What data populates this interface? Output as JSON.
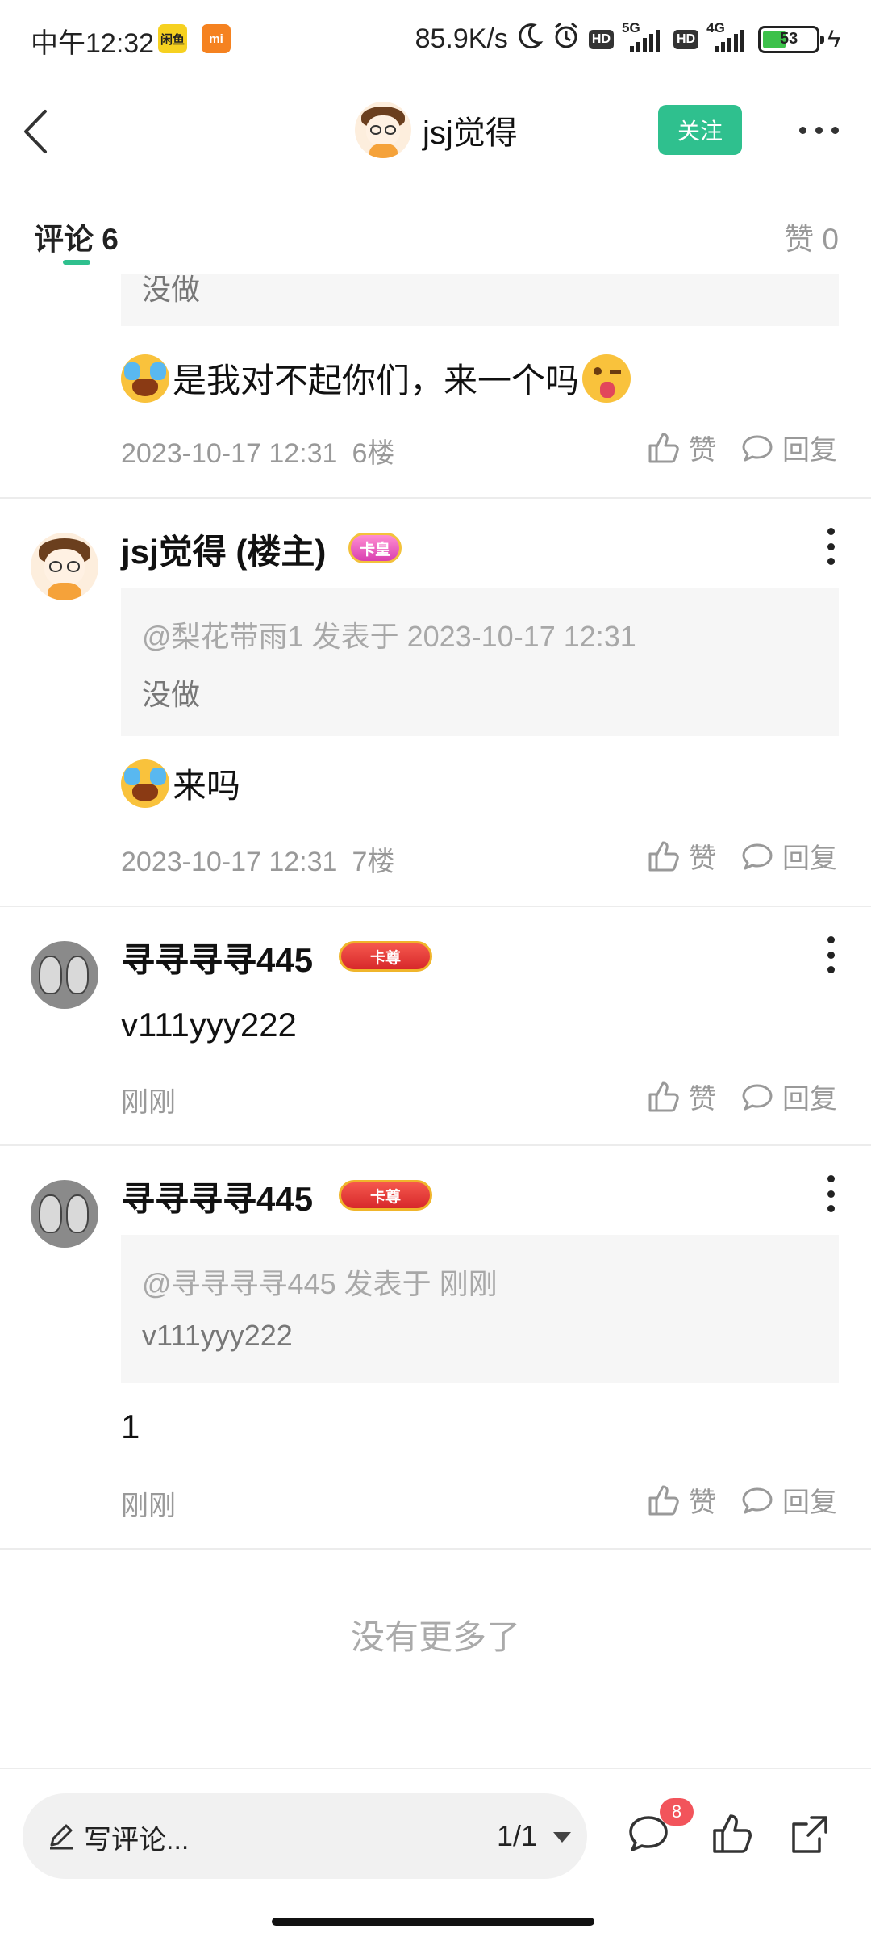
{
  "status_bar": {
    "time": "中午12:32",
    "app_icon_1": "闲鱼",
    "app_icon_2": "mi",
    "net_speed": "85.9K/s",
    "hd_1": "HD",
    "net_1": "5G",
    "hd_2": "HD",
    "net_2": "4G",
    "battery": "53"
  },
  "header": {
    "username": "jsj觉得",
    "follow_label": "关注"
  },
  "tabs": {
    "comments_label": "评论 6",
    "likes_label": "赞 0"
  },
  "comments": [
    {
      "quote_text": "没做",
      "text": "是我对不起你们，来一个吗",
      "emojis": [
        "crying-emoji",
        "wink-emoji"
      ],
      "time": "2023-10-17 12:31",
      "floor": "6楼",
      "like_label": "赞",
      "reply_label": "回复"
    },
    {
      "name": "jsj觉得 (楼主)",
      "badge": "卡皇",
      "quote_head": "@梨花带雨1 发表于 2023-10-17 12:31",
      "quote_text": "没做",
      "text": "来吗",
      "emojis": [
        "crying-emoji"
      ],
      "time": "2023-10-17 12:31",
      "floor": "7楼",
      "like_label": "赞",
      "reply_label": "回复"
    },
    {
      "name": "寻寻寻寻445",
      "badge": "卡尊",
      "text": "v111yyy222",
      "time": "刚刚",
      "like_label": "赞",
      "reply_label": "回复"
    },
    {
      "name": "寻寻寻寻445",
      "badge": "卡尊",
      "quote_head": "@寻寻寻寻445 发表于 刚刚",
      "quote_text": "v111yyy222",
      "text": "1",
      "time": "刚刚",
      "like_label": "赞",
      "reply_label": "回复"
    }
  ],
  "footer_text": "没有更多了",
  "bottom_bar": {
    "write_placeholder": "写评论...",
    "page_indicator": "1/1",
    "comment_count": "8"
  },
  "colors": {
    "accent": "#2fc08e",
    "badge_red": "#f2545b"
  }
}
